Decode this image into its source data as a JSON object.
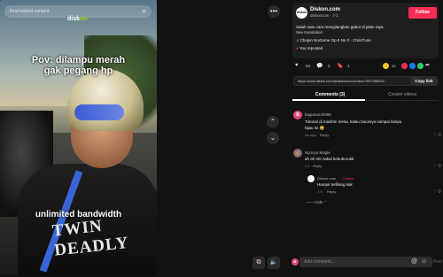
{
  "video": {
    "search_placeholder": "Find related content",
    "logo_prefix": "disk",
    "logo_suffix": "on",
    "caption_top_line1": "Pov: dilampu merah",
    "caption_top_line2": "gak pegang hp",
    "caption_bottom": "unlimited bandwidth",
    "shirt_text": "TWIN DEADLY"
  },
  "controls": {
    "more": "•••",
    "prev": "⌃",
    "next": "⌄"
  },
  "post": {
    "display_name": "Diskon.com",
    "username": "diskoncom",
    "date": "7-1",
    "follow_label": "Follow",
    "description": "Salah satu cara mengilangkan gabut di jalan raya",
    "see_translation": "See translation",
    "music": "Chopin Nocturne Op 9 No 2 - ChrisTune",
    "reposted": "You reposted",
    "likes": "5K",
    "comments": "3",
    "saves": "1",
    "share_count": "43",
    "url": "https://www.tiktok.com/@diskoncom/video/7657368522...",
    "copy_label": "Copy link",
    "avatar_text": "diskon"
  },
  "tabs": {
    "comments": "Comments (3)",
    "creator_videos": "Creator videos"
  },
  "comments": [
    {
      "user": "bagusandri965",
      "initial": "B",
      "text_line1": "Tutorial di masihin mesa, kalau bacanya sampai lampu",
      "text_line2": "hijau ini 😂",
      "date": "3w ago",
      "reply": "Reply",
      "likes": "0"
    },
    {
      "user": "Nyonya Magie",
      "initial": "",
      "text_line1": "ah ah min takut kebuburukk",
      "text_line2": "",
      "date": "7-1",
      "reply": "Reply",
      "likes": "0"
    },
    {
      "user": "Diskon.com",
      "badge": "Creator",
      "initial": "",
      "text_line1": "Hampir terlilang kak",
      "text_line2": "",
      "date": "7-9",
      "reply": "Reply",
      "likes": "0"
    }
  ],
  "hide_label": "Hide",
  "comment_placeholder": "Add comment...",
  "colors": {
    "accent": "#fe2c55",
    "background": "#121212",
    "panel": "#1e1e1e"
  }
}
